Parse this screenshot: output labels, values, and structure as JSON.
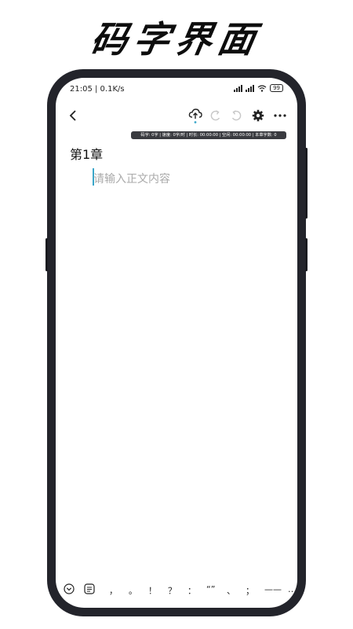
{
  "banner": {
    "title": "码字界面"
  },
  "status_bar": {
    "time_speed": "21:05 | 0.1K/s",
    "battery": "99"
  },
  "stats": {
    "text": "码字: 0字 | 速度: 0字/时 | 时长: 00:00:00 | 空闲: 00:00:00 | 本章字数: 0"
  },
  "chapter": {
    "title": "第1章"
  },
  "editor": {
    "placeholder": "请输入正文内容"
  },
  "keyboard_bar": {
    "symbols": [
      "，",
      "。",
      "！",
      "？",
      "：",
      "“”",
      "、",
      "；",
      "——",
      "…"
    ]
  }
}
